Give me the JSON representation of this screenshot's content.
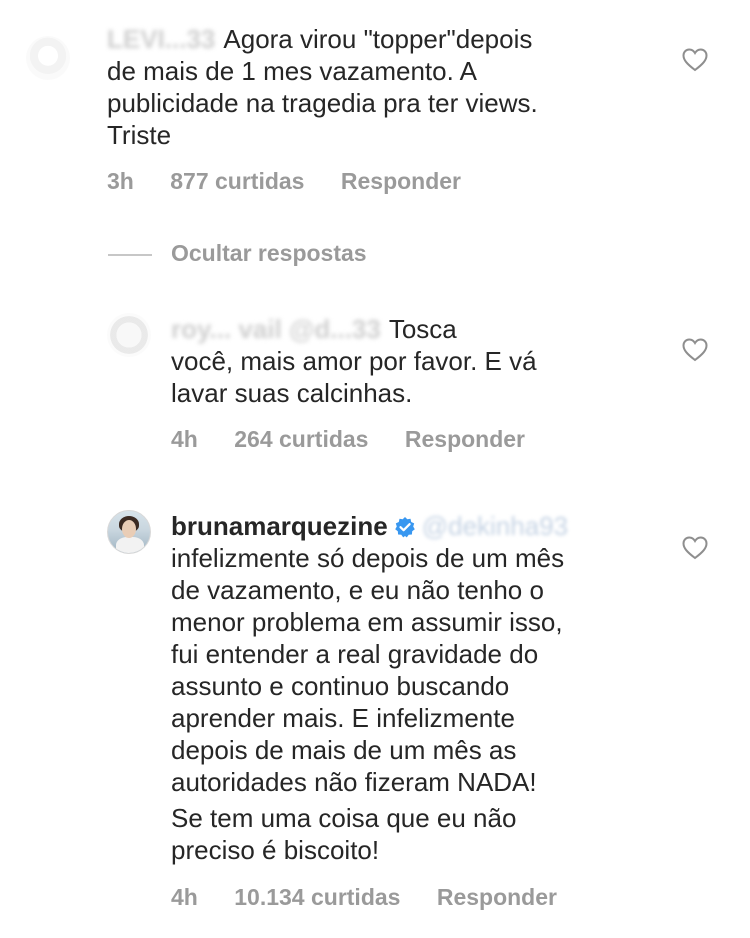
{
  "comments": [
    {
      "username": "LEVI...33",
      "text": "Agora  virou \"topper\"depois\nde mais de 1 mes vazamento. A\npublicidade na tragedia pra ter views.\nTriste",
      "time": "3h",
      "likes": "877 curtidas",
      "reply": "Responder"
    },
    {
      "username": "roy... vail @d...33",
      "text": "Tosca",
      "text_rest": "você,  mais amor por favor. E vá\nlavar suas calcinhas.",
      "time": "4h",
      "likes": "264 curtidas",
      "reply": "Responder"
    },
    {
      "username": "brunamarquezine",
      "mention": "@dekinha93",
      "text": "infelizmente só depois de um mês\nde vazamento, e eu não tenho o\nmenor problema em assumir isso,\nfui entender a real gravidade do\nassunto e continuo buscando\naprender mais. E infelizmente\ndepois de mais de um mês as\nautoridades não fizeram NADA!",
      "text2": "Se tem uma coisa que eu não\npreciso é biscoito!",
      "time": "4h",
      "likes": "10.134 curtidas",
      "reply": "Responder"
    }
  ],
  "hide_replies": "Ocultar respostas",
  "colors": {
    "meta": "#9a9a9a",
    "text": "#262626",
    "verified": "#3897f0"
  },
  "icons": {
    "like": "heart-outline-icon",
    "verified": "verified-badge-icon"
  }
}
